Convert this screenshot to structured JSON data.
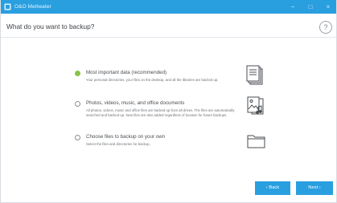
{
  "window": {
    "title": "O&O Meltwater",
    "controls": [
      "−",
      "□",
      "×"
    ]
  },
  "header": {
    "question": "What do you want to backup?",
    "help_glyph": "?"
  },
  "options": [
    {
      "title": "Most important data (recommended)",
      "description": "Your personal directories, your files on the desktop, and all the libraries are backed up.",
      "selected": true,
      "icon": "documents-stack-icon"
    },
    {
      "title": "Photos, videos, music, and office documents",
      "description": "All photos, videos, music and office files are backed up from all drives. The files are automatically searched and backed up. New files are also added regardless of location for future backups.",
      "selected": false,
      "icon": "media-files-icon"
    },
    {
      "title": "Choose files to backup on your own",
      "description": "Select the files and directories for backup.",
      "selected": false,
      "icon": "folder-icon"
    }
  ],
  "footer": {
    "back_label": "‹  Back",
    "next_label": "Next  ›"
  },
  "colors": {
    "accent": "#2a9fe0",
    "selected_radio": "#86c34a",
    "icon_stroke": "#4a4e53"
  }
}
